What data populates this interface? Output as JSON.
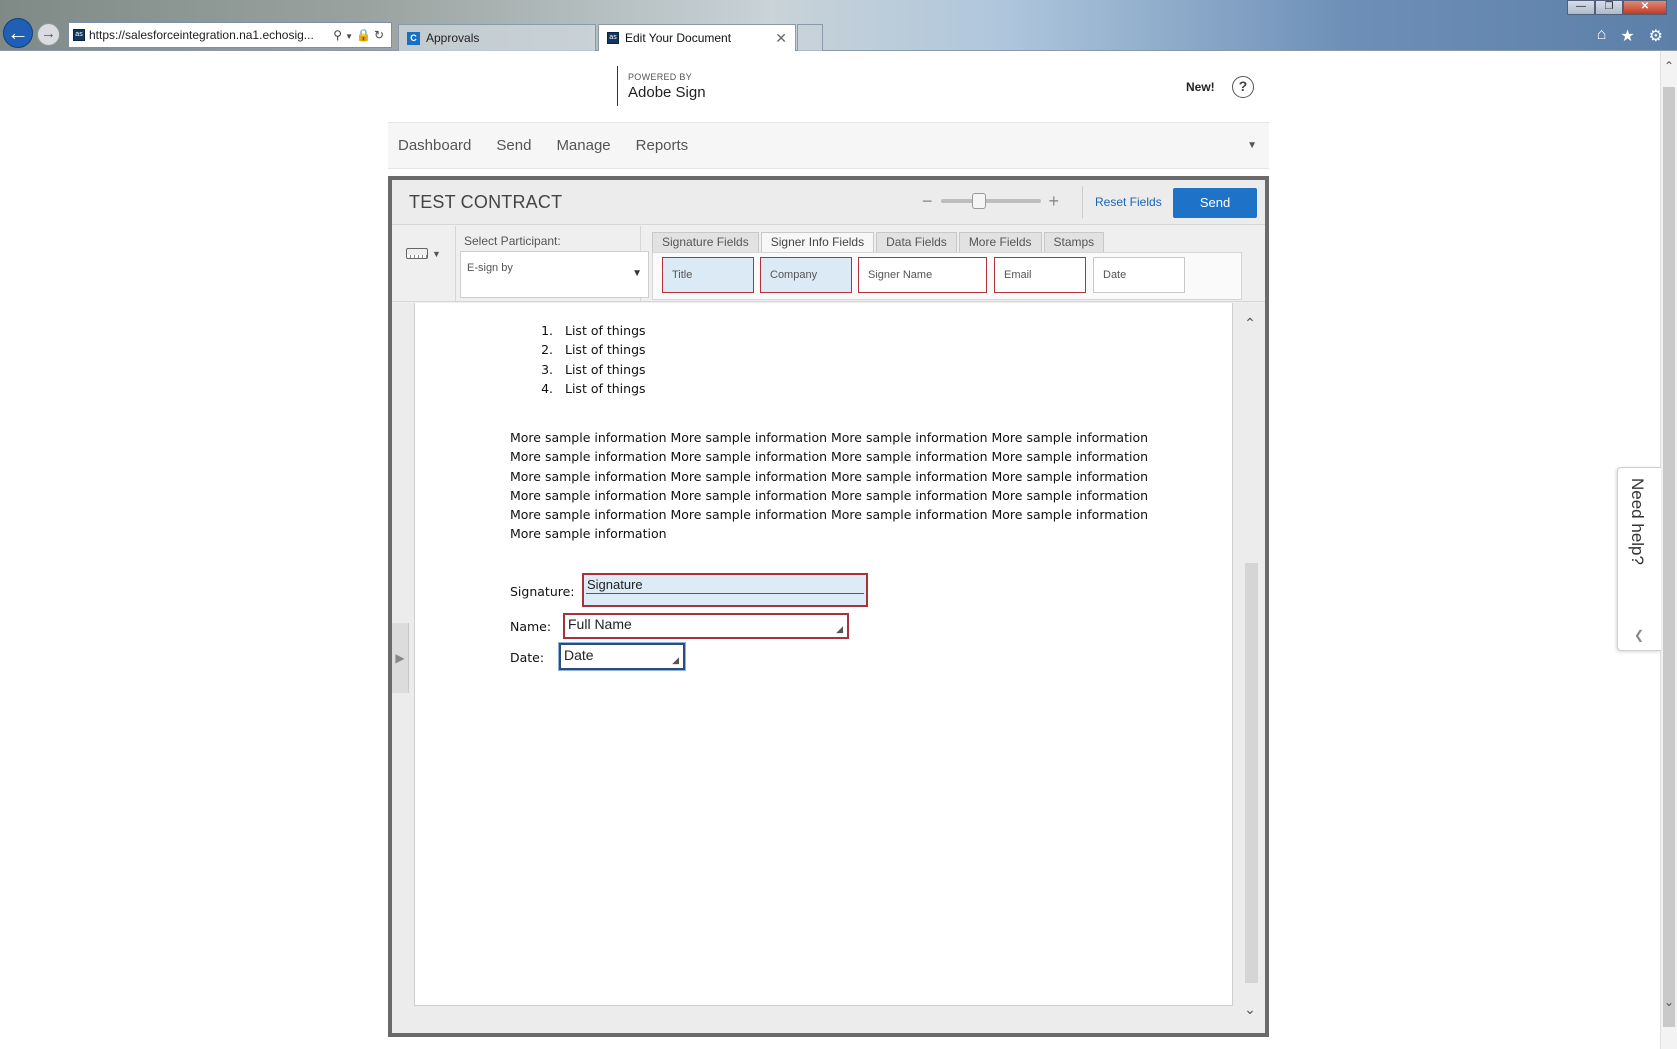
{
  "browser": {
    "address": {
      "prefix": "https://salesforceintegration.na1",
      "domain": ".echosig..."
    },
    "tabs": [
      {
        "label": "Approvals"
      },
      {
        "label": "Edit Your Document"
      }
    ],
    "icons": [
      "back-arrow-icon",
      "forward-arrow-icon",
      "search-icon",
      "lock-icon",
      "refresh-icon",
      "home-icon",
      "favorites-star-icon",
      "settings-gear-icon"
    ]
  },
  "header": {
    "powered_by": "POWERED BY",
    "brand": "Adobe Sign",
    "new_label": "New!",
    "help": "?"
  },
  "nav": {
    "items": [
      "Dashboard",
      "Send",
      "Manage",
      "Reports"
    ]
  },
  "editor": {
    "title": "TEST CONTRACT",
    "reset_fields": "Reset Fields",
    "send": "Send",
    "zoom_level": 0.38,
    "participant_label": "Select Participant:",
    "participant_value": "E-sign by",
    "field_tabs": [
      "Signature Fields",
      "Signer Info Fields",
      "Data Fields",
      "More Fields",
      "Stamps"
    ],
    "active_tab": "Signer Info Fields",
    "palette_fields": [
      {
        "label": "Title",
        "style": "blue"
      },
      {
        "label": "Company",
        "style": "blue"
      },
      {
        "label": "Signer Name",
        "style": "white"
      },
      {
        "label": "Email",
        "style": "white"
      },
      {
        "label": "Date",
        "style": "white-gray"
      }
    ]
  },
  "document": {
    "list": [
      {
        "num": "1.",
        "text": "List of things"
      },
      {
        "num": "2.",
        "text": "List of things"
      },
      {
        "num": "3.",
        "text": "List of things"
      },
      {
        "num": "4.",
        "text": "List of things"
      }
    ],
    "paragraph_lines": [
      "More sample information More sample information More sample information More sample information",
      "More sample information More sample information More sample information More sample information",
      "More sample information More sample information More sample information More sample information",
      "More sample information More sample information More sample information More sample information",
      "More sample information More sample information More sample information More sample information",
      "More sample information"
    ],
    "signature_label": "Signature:",
    "signature_field": "Signature",
    "name_label": "Name:",
    "name_field": "Full Name",
    "date_label": "Date:",
    "date_field": "Date"
  },
  "need_help": "Need help?",
  "colors": {
    "accent": "#1e73c9",
    "field_border": "#a8323a",
    "field_fill": "#dbeaf5",
    "frame": "#6a6a6a"
  }
}
